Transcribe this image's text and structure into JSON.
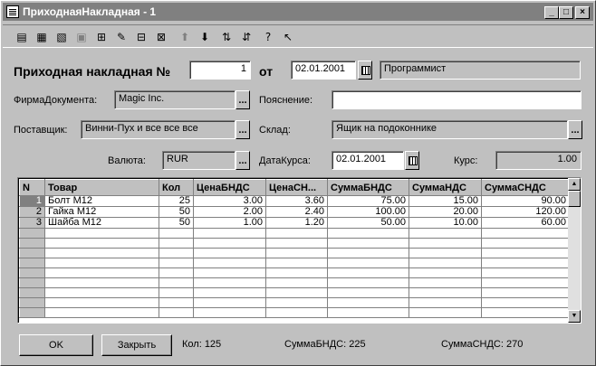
{
  "window": {
    "title": "ПриходнаяНакладная - 1",
    "controls": [
      "_",
      "□",
      "×"
    ]
  },
  "toolbar": {
    "tools": [
      {
        "icon": "new-row-icon",
        "glyph": "▤",
        "disabled": false
      },
      {
        "icon": "insert-row-icon",
        "glyph": "▦",
        "disabled": false
      },
      {
        "icon": "delete-row-icon",
        "glyph": "▧",
        "disabled": false
      },
      {
        "icon": "copy-row-icon",
        "glyph": "▣",
        "disabled": true
      },
      {
        "icon": "find-icon",
        "glyph": "⊞",
        "disabled": false
      },
      {
        "icon": "edit-icon",
        "glyph": "✎",
        "disabled": false
      },
      {
        "icon": "open-icon",
        "glyph": "⊟",
        "disabled": false
      },
      {
        "icon": "properties-icon",
        "glyph": "⊠",
        "disabled": false
      },
      {
        "icon": "move-up-icon",
        "glyph": "⬆",
        "disabled": true
      },
      {
        "icon": "move-down-icon",
        "glyph": "⬇",
        "disabled": false
      },
      {
        "icon": "sort-asc-icon",
        "glyph": "⇅",
        "disabled": false
      },
      {
        "icon": "sort-desc-icon",
        "glyph": "⇵",
        "disabled": false
      },
      {
        "icon": "help-icon",
        "glyph": "?",
        "disabled": false
      },
      {
        "icon": "context-help-icon",
        "glyph": "↖",
        "disabled": false
      }
    ]
  },
  "header": {
    "title": "Приходная накладная №",
    "number": "1",
    "from_label": "от",
    "date": "02.01.2001",
    "author": "Программист"
  },
  "form": {
    "firm_label": "ФирмаДокумента:",
    "firm_value": "Magic Inc.",
    "note_label": "Пояснение:",
    "note_value": "",
    "supplier_label": "Поставщик:",
    "supplier_value": "Винни-Пух и все все все",
    "warehouse_label": "Склад:",
    "warehouse_value": "Ящик на подоконнике",
    "currency_label": "Валюта:",
    "currency_value": "RUR",
    "rate_date_label": "ДатаКурса:",
    "rate_date_value": "02.01.2001",
    "rate_label": "Курс:",
    "rate_value": "1.00",
    "ellipsis": "..."
  },
  "table": {
    "columns": [
      "N",
      "Товар",
      "Кол",
      "ЦенаБНДС",
      "ЦенаСН...",
      "СуммаБНДС",
      "СуммаНДС",
      "СуммаСНДС"
    ],
    "rows": [
      [
        "1",
        "Болт М12",
        "25",
        "3.00",
        "3.60",
        "75.00",
        "15.00",
        "90.00"
      ],
      [
        "2",
        "Гайка М12",
        "50",
        "2.00",
        "2.40",
        "100.00",
        "20.00",
        "120.00"
      ],
      [
        "3",
        "Шайба М12",
        "50",
        "1.00",
        "1.20",
        "50.00",
        "10.00",
        "60.00"
      ]
    ],
    "scroll_up": "▲",
    "scroll_down": "▼"
  },
  "footer": {
    "ok_label": "OK",
    "close_label": "Закрыть",
    "qty_total": "Кол:  125",
    "sum_no_vat_total": "СуммаБНДС:  225",
    "sum_with_vat_total": "СуммаСНДС:  270"
  }
}
